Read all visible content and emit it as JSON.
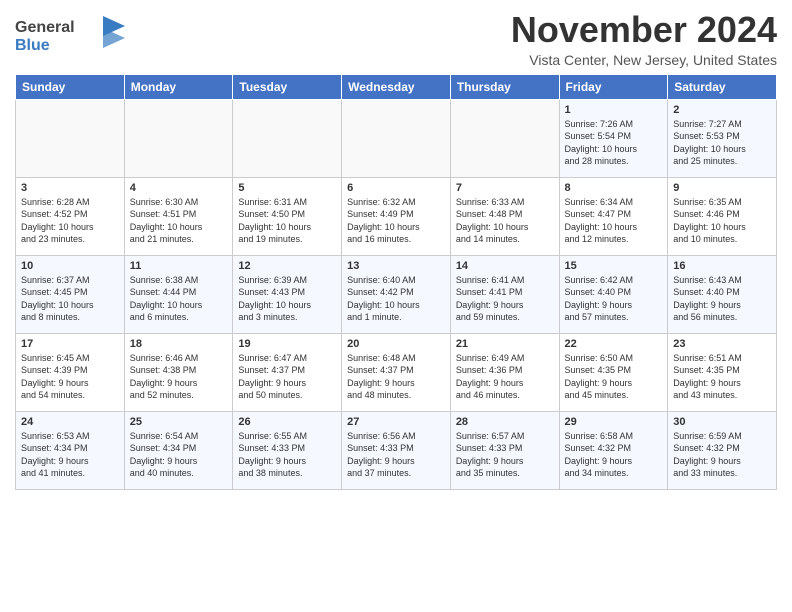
{
  "header": {
    "logo_general": "General",
    "logo_blue": "Blue",
    "month_title": "November 2024",
    "subtitle": "Vista Center, New Jersey, United States"
  },
  "days_of_week": [
    "Sunday",
    "Monday",
    "Tuesday",
    "Wednesday",
    "Thursday",
    "Friday",
    "Saturday"
  ],
  "weeks": [
    [
      {
        "day": "",
        "info": ""
      },
      {
        "day": "",
        "info": ""
      },
      {
        "day": "",
        "info": ""
      },
      {
        "day": "",
        "info": ""
      },
      {
        "day": "",
        "info": ""
      },
      {
        "day": "1",
        "info": "Sunrise: 7:26 AM\nSunset: 5:54 PM\nDaylight: 10 hours\nand 28 minutes."
      },
      {
        "day": "2",
        "info": "Sunrise: 7:27 AM\nSunset: 5:53 PM\nDaylight: 10 hours\nand 25 minutes."
      }
    ],
    [
      {
        "day": "3",
        "info": "Sunrise: 6:28 AM\nSunset: 4:52 PM\nDaylight: 10 hours\nand 23 minutes."
      },
      {
        "day": "4",
        "info": "Sunrise: 6:30 AM\nSunset: 4:51 PM\nDaylight: 10 hours\nand 21 minutes."
      },
      {
        "day": "5",
        "info": "Sunrise: 6:31 AM\nSunset: 4:50 PM\nDaylight: 10 hours\nand 19 minutes."
      },
      {
        "day": "6",
        "info": "Sunrise: 6:32 AM\nSunset: 4:49 PM\nDaylight: 10 hours\nand 16 minutes."
      },
      {
        "day": "7",
        "info": "Sunrise: 6:33 AM\nSunset: 4:48 PM\nDaylight: 10 hours\nand 14 minutes."
      },
      {
        "day": "8",
        "info": "Sunrise: 6:34 AM\nSunset: 4:47 PM\nDaylight: 10 hours\nand 12 minutes."
      },
      {
        "day": "9",
        "info": "Sunrise: 6:35 AM\nSunset: 4:46 PM\nDaylight: 10 hours\nand 10 minutes."
      }
    ],
    [
      {
        "day": "10",
        "info": "Sunrise: 6:37 AM\nSunset: 4:45 PM\nDaylight: 10 hours\nand 8 minutes."
      },
      {
        "day": "11",
        "info": "Sunrise: 6:38 AM\nSunset: 4:44 PM\nDaylight: 10 hours\nand 6 minutes."
      },
      {
        "day": "12",
        "info": "Sunrise: 6:39 AM\nSunset: 4:43 PM\nDaylight: 10 hours\nand 3 minutes."
      },
      {
        "day": "13",
        "info": "Sunrise: 6:40 AM\nSunset: 4:42 PM\nDaylight: 10 hours\nand 1 minute."
      },
      {
        "day": "14",
        "info": "Sunrise: 6:41 AM\nSunset: 4:41 PM\nDaylight: 9 hours\nand 59 minutes."
      },
      {
        "day": "15",
        "info": "Sunrise: 6:42 AM\nSunset: 4:40 PM\nDaylight: 9 hours\nand 57 minutes."
      },
      {
        "day": "16",
        "info": "Sunrise: 6:43 AM\nSunset: 4:40 PM\nDaylight: 9 hours\nand 56 minutes."
      }
    ],
    [
      {
        "day": "17",
        "info": "Sunrise: 6:45 AM\nSunset: 4:39 PM\nDaylight: 9 hours\nand 54 minutes."
      },
      {
        "day": "18",
        "info": "Sunrise: 6:46 AM\nSunset: 4:38 PM\nDaylight: 9 hours\nand 52 minutes."
      },
      {
        "day": "19",
        "info": "Sunrise: 6:47 AM\nSunset: 4:37 PM\nDaylight: 9 hours\nand 50 minutes."
      },
      {
        "day": "20",
        "info": "Sunrise: 6:48 AM\nSunset: 4:37 PM\nDaylight: 9 hours\nand 48 minutes."
      },
      {
        "day": "21",
        "info": "Sunrise: 6:49 AM\nSunset: 4:36 PM\nDaylight: 9 hours\nand 46 minutes."
      },
      {
        "day": "22",
        "info": "Sunrise: 6:50 AM\nSunset: 4:35 PM\nDaylight: 9 hours\nand 45 minutes."
      },
      {
        "day": "23",
        "info": "Sunrise: 6:51 AM\nSunset: 4:35 PM\nDaylight: 9 hours\nand 43 minutes."
      }
    ],
    [
      {
        "day": "24",
        "info": "Sunrise: 6:53 AM\nSunset: 4:34 PM\nDaylight: 9 hours\nand 41 minutes."
      },
      {
        "day": "25",
        "info": "Sunrise: 6:54 AM\nSunset: 4:34 PM\nDaylight: 9 hours\nand 40 minutes."
      },
      {
        "day": "26",
        "info": "Sunrise: 6:55 AM\nSunset: 4:33 PM\nDaylight: 9 hours\nand 38 minutes."
      },
      {
        "day": "27",
        "info": "Sunrise: 6:56 AM\nSunset: 4:33 PM\nDaylight: 9 hours\nand 37 minutes."
      },
      {
        "day": "28",
        "info": "Sunrise: 6:57 AM\nSunset: 4:33 PM\nDaylight: 9 hours\nand 35 minutes."
      },
      {
        "day": "29",
        "info": "Sunrise: 6:58 AM\nSunset: 4:32 PM\nDaylight: 9 hours\nand 34 minutes."
      },
      {
        "day": "30",
        "info": "Sunrise: 6:59 AM\nSunset: 4:32 PM\nDaylight: 9 hours\nand 33 minutes."
      }
    ]
  ]
}
